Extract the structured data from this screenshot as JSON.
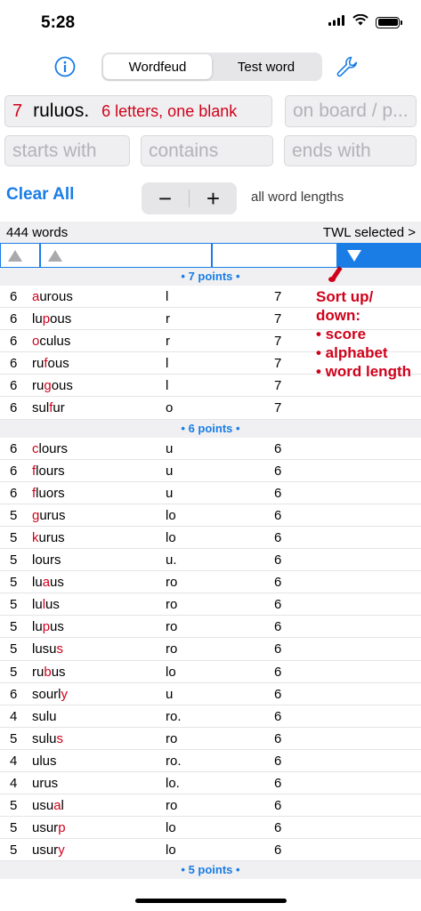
{
  "status": {
    "time": "5:28"
  },
  "nav": {
    "segments": [
      "Wordfeud",
      "Test word"
    ],
    "selected_segment": "Wordfeud"
  },
  "inputs": {
    "rack": {
      "count": "7",
      "letters": "ruluos.",
      "info": "6 letters, one blank"
    },
    "board_placeholder": "on board / p...",
    "starts_placeholder": "starts with",
    "contains_placeholder": "contains",
    "ends_placeholder": "ends with"
  },
  "controls": {
    "clear_all": "Clear All",
    "minus": "−",
    "plus": "+",
    "length_label": "all word lengths"
  },
  "summary": {
    "word_count": "444 words",
    "dictionary": "TWL selected >"
  },
  "colors": {
    "accent": "#1a7de6",
    "highlight": "#d0021b"
  },
  "sections": [
    {
      "label": "• 7 points •",
      "rows": [
        {
          "score": "6",
          "pre": "",
          "hl": "a",
          "post": "urous",
          "rem": "l",
          "len": "7"
        },
        {
          "score": "6",
          "pre": "lu",
          "hl": "p",
          "post": "ous",
          "rem": "r",
          "len": "7"
        },
        {
          "score": "6",
          "pre": "",
          "hl": "o",
          "post": "culus",
          "rem": "r",
          "len": "7"
        },
        {
          "score": "6",
          "pre": "ru",
          "hl": "f",
          "post": "ous",
          "rem": "l",
          "len": "7"
        },
        {
          "score": "6",
          "pre": "ru",
          "hl": "g",
          "post": "ous",
          "rem": "l",
          "len": "7"
        },
        {
          "score": "6",
          "pre": "sul",
          "hl": "f",
          "post": "ur",
          "rem": "o",
          "len": "7"
        }
      ]
    },
    {
      "label": "• 6 points •",
      "rows": [
        {
          "score": "6",
          "pre": "",
          "hl": "c",
          "post": "lours",
          "rem": "u",
          "len": "6"
        },
        {
          "score": "6",
          "pre": "",
          "hl": "f",
          "post": "lours",
          "rem": "u",
          "len": "6"
        },
        {
          "score": "6",
          "pre": "",
          "hl": "f",
          "post": "luors",
          "rem": "u",
          "len": "6"
        },
        {
          "score": "5",
          "pre": "",
          "hl": "g",
          "post": "urus",
          "rem": "lo",
          "len": "6"
        },
        {
          "score": "5",
          "pre": "",
          "hl": "k",
          "post": "urus",
          "rem": "lo",
          "len": "6"
        },
        {
          "score": "5",
          "pre": "lours",
          "hl": "",
          "post": "",
          "rem": "u.",
          "len": "6"
        },
        {
          "score": "5",
          "pre": "lu",
          "hl": "a",
          "post": "us",
          "rem": "ro",
          "len": "6"
        },
        {
          "score": "5",
          "pre": "lu",
          "hl": "l",
          "post": "us",
          "rem": "ro",
          "len": "6"
        },
        {
          "score": "5",
          "pre": "lu",
          "hl": "p",
          "post": "us",
          "rem": "ro",
          "len": "6"
        },
        {
          "score": "5",
          "pre": "lusu",
          "hl": "s",
          "post": "",
          "rem": "ro",
          "len": "6"
        },
        {
          "score": "5",
          "pre": "ru",
          "hl": "b",
          "post": "us",
          "rem": "lo",
          "len": "6"
        },
        {
          "score": "6",
          "pre": "sourl",
          "hl": "y",
          "post": "",
          "rem": "u",
          "len": "6"
        },
        {
          "score": "4",
          "pre": "sulu",
          "hl": "",
          "post": "",
          "rem": "ro.",
          "len": "6"
        },
        {
          "score": "5",
          "pre": "sulu",
          "hl": "s",
          "post": "",
          "rem": "ro",
          "len": "6"
        },
        {
          "score": "4",
          "pre": "ulus",
          "hl": "",
          "post": "",
          "rem": "ro.",
          "len": "6"
        },
        {
          "score": "4",
          "pre": "urus",
          "hl": "",
          "post": "",
          "rem": "lo.",
          "len": "6"
        },
        {
          "score": "5",
          "pre": "usu",
          "hl": "a",
          "post": "l",
          "rem": "ro",
          "len": "6"
        },
        {
          "score": "5",
          "pre": "usur",
          "hl": "p",
          "post": "",
          "rem": "lo",
          "len": "6"
        },
        {
          "score": "5",
          "pre": "usur",
          "hl": "y",
          "post": "",
          "rem": "lo",
          "len": "6"
        }
      ]
    },
    {
      "label": "• 5 points •",
      "rows": []
    }
  ],
  "annotation": {
    "lines": [
      "Sort up/",
      "down:",
      "• score",
      "• alphabet",
      "• word length"
    ]
  }
}
